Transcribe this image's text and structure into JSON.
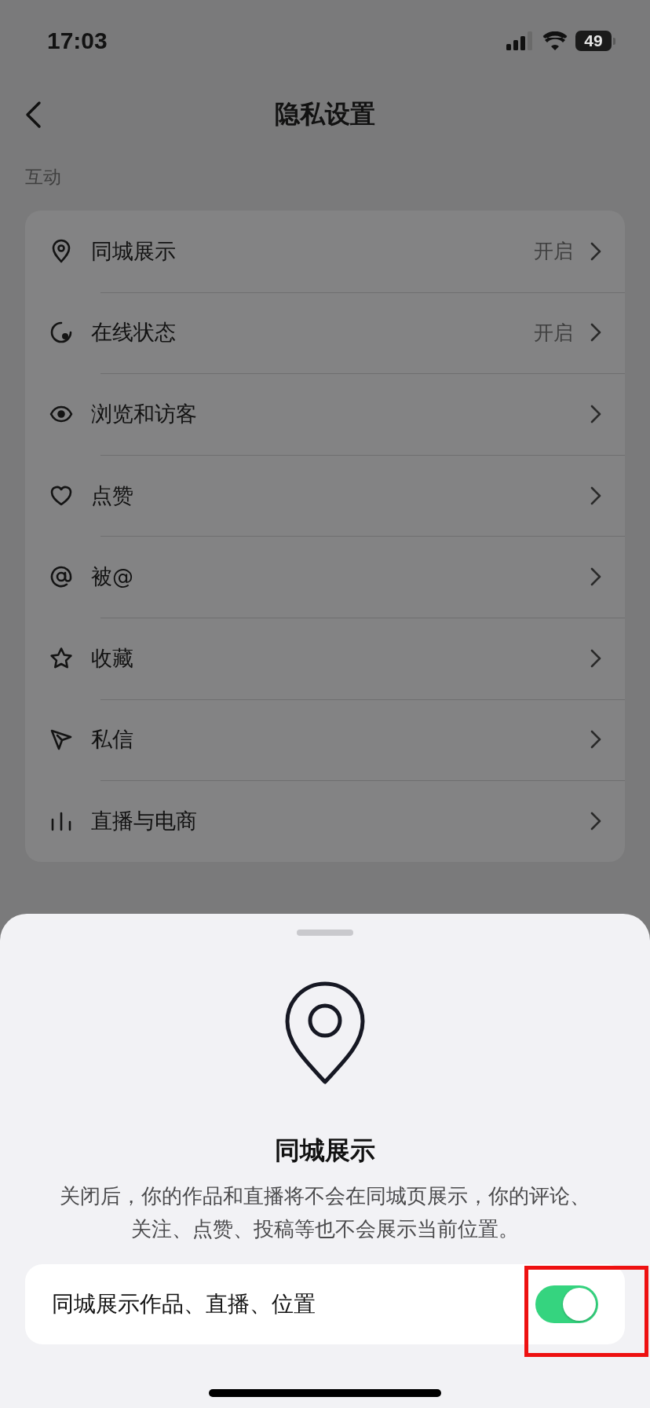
{
  "status_bar": {
    "time": "17:03",
    "battery": "49"
  },
  "nav": {
    "title": "隐私设置"
  },
  "sections": [
    {
      "title": "互动",
      "items": [
        {
          "label": "同城展示",
          "value": "开启"
        },
        {
          "label": "在线状态",
          "value": "开启"
        },
        {
          "label": "浏览和访客"
        },
        {
          "label": "点赞"
        },
        {
          "label": "被@"
        },
        {
          "label": "收藏"
        },
        {
          "label": "私信"
        },
        {
          "label": "直播与电商"
        }
      ]
    }
  ],
  "sheet": {
    "title": "同城展示",
    "description": "关闭后，你的作品和直播将不会在同城页展示，你的评论、关注、点赞、投稿等也不会展示当前位置。",
    "toggle": {
      "label": "同城展示作品、直播、位置",
      "on": true,
      "highlighted": true
    }
  }
}
